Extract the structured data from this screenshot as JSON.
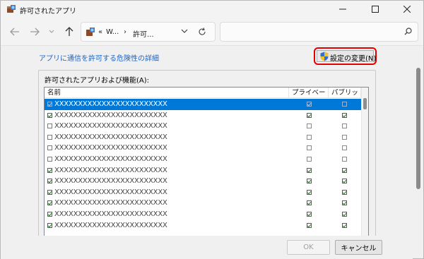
{
  "window": {
    "title": "許可されたアプリ"
  },
  "titlebar": {
    "minimize": "—",
    "maximize": "☐",
    "close": "✕"
  },
  "address": {
    "crumbs": [
      "«",
      "W...",
      "›",
      "許可..."
    ],
    "search_placeholder": ""
  },
  "content": {
    "risk_link": "アプリに通信を許可する危険性の詳細",
    "change_settings_label": "設定の変更(N)",
    "group_title": "許可されたアプリおよび機能(A):",
    "columns": {
      "name": "名前",
      "private": "プライベート",
      "public": "パブリック"
    },
    "rows": [
      {
        "name": "XXXXXXXXXXXXXXXXXXXXXXXX",
        "enabled": true,
        "private": true,
        "public": false,
        "selected": true
      },
      {
        "name": "XXXXXXXXXXXXXXXXXXXXXXXX",
        "enabled": true,
        "private": true,
        "public": true,
        "selected": false
      },
      {
        "name": "XXXXXXXXXXXXXXXXXXXXXXXX",
        "enabled": false,
        "private": false,
        "public": false,
        "selected": false
      },
      {
        "name": "XXXXXXXXXXXXXXXXXXXXXXXX",
        "enabled": false,
        "private": false,
        "public": false,
        "selected": false
      },
      {
        "name": "XXXXXXXXXXXXXXXXXXXXXXXX",
        "enabled": false,
        "private": false,
        "public": false,
        "selected": false
      },
      {
        "name": "XXXXXXXXXXXXXXXXXXXXXXXX",
        "enabled": false,
        "private": false,
        "public": false,
        "selected": false
      },
      {
        "name": "XXXXXXXXXXXXXXXXXXXXXXXX",
        "enabled": true,
        "private": true,
        "public": true,
        "selected": false
      },
      {
        "name": "XXXXXXXXXXXXXXXXXXXXXXXX",
        "enabled": true,
        "private": true,
        "public": true,
        "selected": false
      },
      {
        "name": "XXXXXXXXXXXXXXXXXXXXXXXX",
        "enabled": true,
        "private": true,
        "public": true,
        "selected": false
      },
      {
        "name": "XXXXXXXXXXXXXXXXXXXXXXXX",
        "enabled": true,
        "private": true,
        "public": true,
        "selected": false
      },
      {
        "name": "XXXXXXXXXXXXXXXXXXXXXXXX",
        "enabled": true,
        "private": true,
        "public": true,
        "selected": false
      },
      {
        "name": "XXXXXXXXXXXXXXXXXXXXXXXX",
        "enabled": true,
        "private": true,
        "public": true,
        "selected": false
      }
    ]
  },
  "footer": {
    "ok_label": "OK",
    "cancel_label": "キャンセル"
  },
  "colors": {
    "accent": "#0078d7",
    "highlight_border": "#e10000",
    "link": "#1a66c9"
  }
}
